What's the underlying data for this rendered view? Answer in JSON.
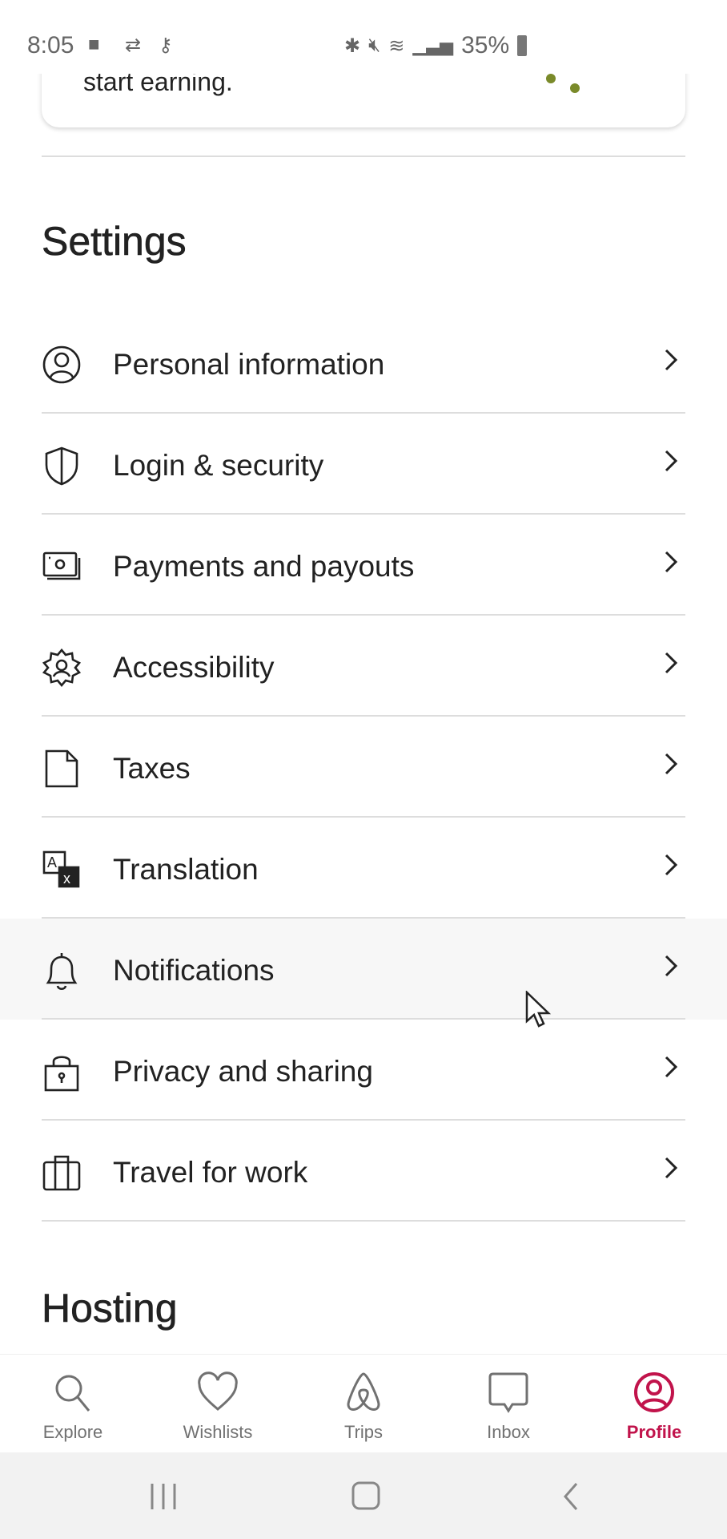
{
  "status_bar": {
    "time": "8:05",
    "battery": "35%",
    "icons": [
      "video-icon",
      "sync-icon",
      "key-icon",
      "bluetooth-icon",
      "mute-icon",
      "wifi-icon",
      "signal-icon",
      "battery-icon"
    ]
  },
  "card": {
    "text": "start earning."
  },
  "settings": {
    "title": "Settings",
    "items": [
      {
        "label": "Personal information",
        "icon": "user-circle-icon"
      },
      {
        "label": "Login & security",
        "icon": "shield-icon"
      },
      {
        "label": "Payments and payouts",
        "icon": "payment-icon"
      },
      {
        "label": "Accessibility",
        "icon": "gear-icon"
      },
      {
        "label": "Taxes",
        "icon": "document-icon"
      },
      {
        "label": "Translation",
        "icon": "translate-icon"
      },
      {
        "label": "Notifications",
        "icon": "bell-icon"
      },
      {
        "label": "Privacy and sharing",
        "icon": "lock-icon"
      },
      {
        "label": "Travel for work",
        "icon": "briefcase-icon"
      }
    ]
  },
  "hosting": {
    "title": "Hosting"
  },
  "bottom_nav": {
    "items": [
      {
        "label": "Explore"
      },
      {
        "label": "Wishlists"
      },
      {
        "label": "Trips"
      },
      {
        "label": "Inbox"
      },
      {
        "label": "Profile",
        "active": true
      }
    ]
  },
  "colors": {
    "accent": "#c1134b",
    "text": "#222222",
    "muted": "#717171"
  }
}
